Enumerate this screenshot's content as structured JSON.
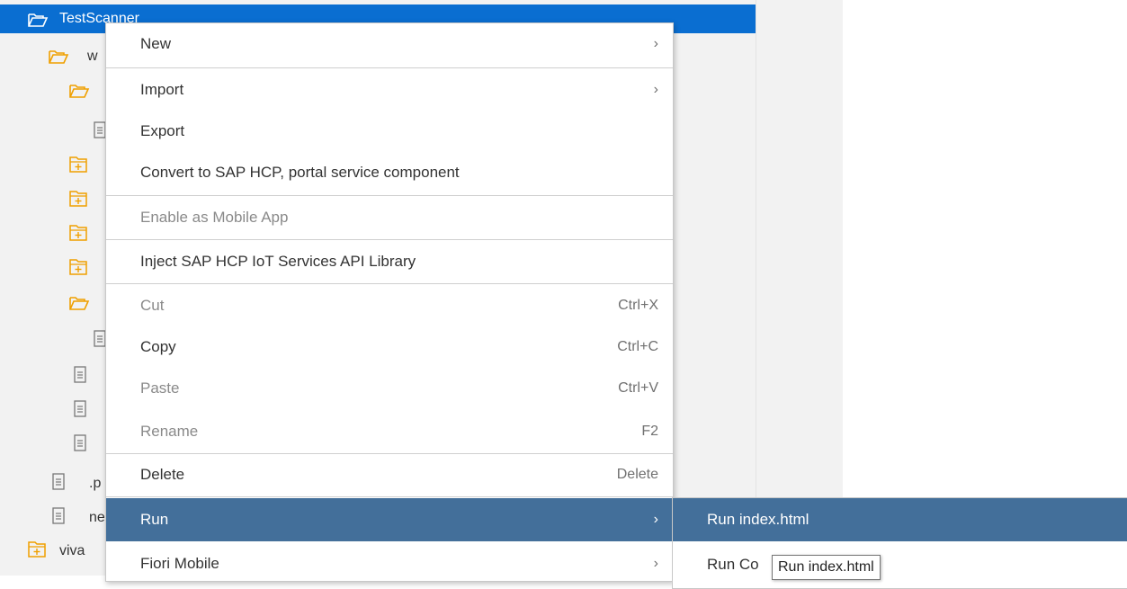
{
  "tree": {
    "rows": [
      {
        "label": "TestScanner",
        "icon": "folder-open-icon",
        "selected": true
      },
      {
        "label": "w",
        "icon": "folder-open-icon"
      },
      {
        "label": "",
        "icon": "folder-open-icon"
      },
      {
        "label": "",
        "icon": "file-icon"
      },
      {
        "label": "",
        "icon": "folder-plus-icon"
      },
      {
        "label": "",
        "icon": "folder-plus-icon"
      },
      {
        "label": "",
        "icon": "folder-plus-icon"
      },
      {
        "label": "",
        "icon": "folder-plus-icon"
      },
      {
        "label": "",
        "icon": "folder-open-icon"
      },
      {
        "label": "",
        "icon": "file-icon"
      },
      {
        "label": "",
        "icon": "file-icon"
      },
      {
        "label": "",
        "icon": "file-icon"
      },
      {
        "label": "",
        "icon": "file-icon"
      },
      {
        "label": ".p",
        "icon": "file-icon"
      },
      {
        "label": "ne",
        "icon": "file-icon"
      },
      {
        "label": "viva",
        "icon": "folder-plus-icon"
      }
    ]
  },
  "menu": {
    "new": {
      "label": "New",
      "right": "›"
    },
    "import": {
      "label": "Import",
      "right": "›"
    },
    "export": {
      "label": "Export"
    },
    "convert": {
      "label": "Convert to SAP HCP, portal service component"
    },
    "enable_mobile": {
      "label": "Enable as Mobile App"
    },
    "inject_iot": {
      "label": "Inject SAP HCP IoT Services API Library"
    },
    "cut": {
      "label": "Cut",
      "shortcut": "Ctrl+X"
    },
    "copy": {
      "label": "Copy",
      "shortcut": "Ctrl+C"
    },
    "paste": {
      "label": "Paste",
      "shortcut": "Ctrl+V"
    },
    "rename": {
      "label": "Rename",
      "shortcut": "F2"
    },
    "delete": {
      "label": "Delete",
      "shortcut": "Delete"
    },
    "run": {
      "label": "Run",
      "right": "›"
    },
    "fiori_mobile": {
      "label": "Fiori Mobile",
      "right": "›"
    }
  },
  "submenu": {
    "run_index": "Run index.html",
    "run_config": "Run Co"
  },
  "tooltip": "Run index.html",
  "colors": {
    "selection": "#0a6ed1",
    "menu_highlight": "#436f9a",
    "folder": "#f0a000",
    "tree_bg": "#f2f2f2"
  }
}
